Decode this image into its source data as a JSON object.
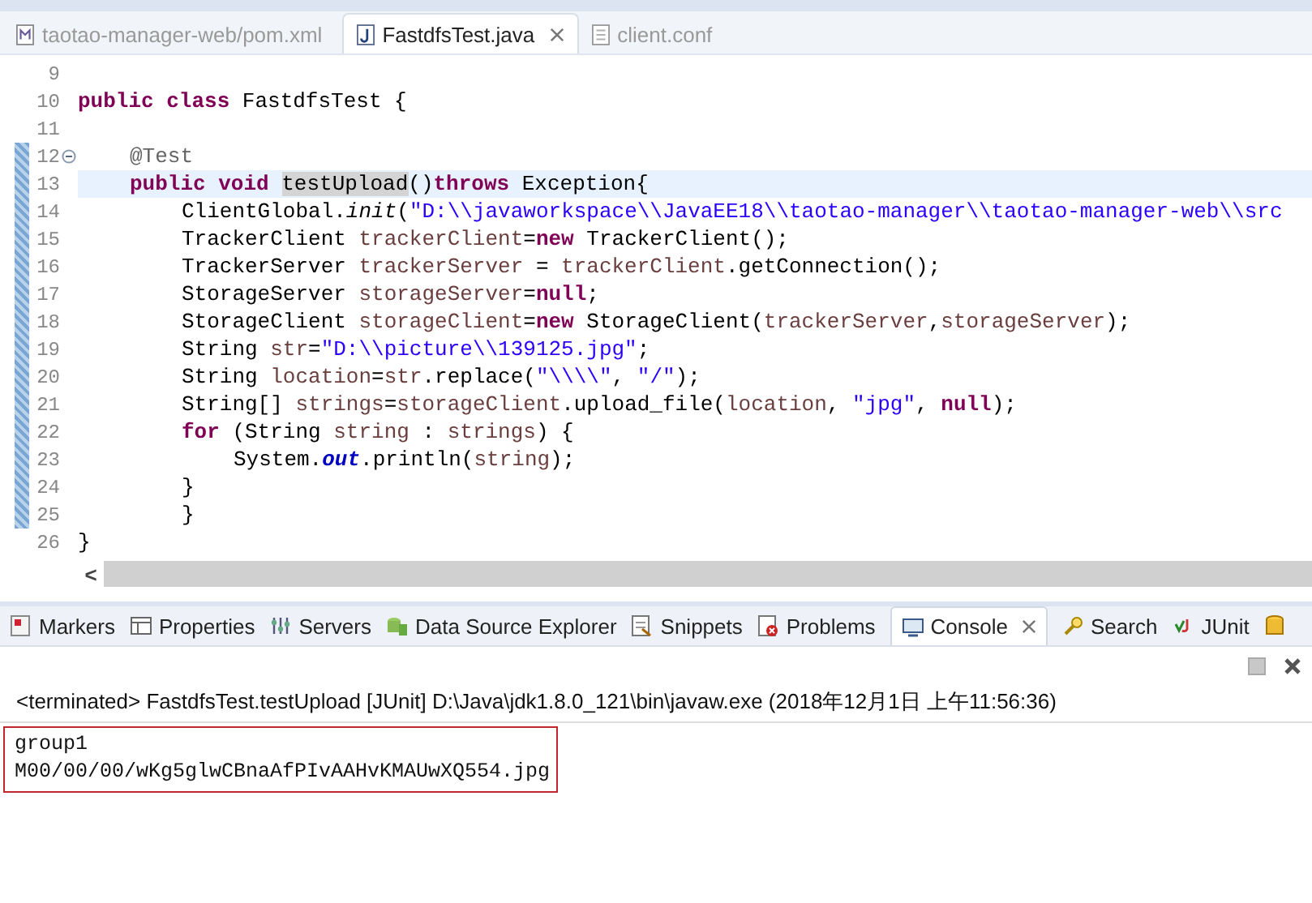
{
  "editor_tabs": [
    {
      "label": "taotao-manager-web/pom.xml",
      "selected": false
    },
    {
      "label": "FastdfsTest.java",
      "selected": true
    },
    {
      "label": "client.conf",
      "selected": false
    }
  ],
  "code_lines": [
    {
      "number": "9",
      "changed": false,
      "current": false,
      "fold": false
    },
    {
      "number": "10",
      "changed": false,
      "current": false,
      "fold": false,
      "segments": [
        {
          "kind": "kw",
          "text": "public "
        },
        {
          "kind": "kw",
          "text": "class"
        },
        {
          "kind": "plain",
          "text": " FastdfsTest {"
        }
      ],
      "children": [
        {
          "number": "11",
          "changed": false,
          "current": false,
          "fold": false
        },
        {
          "number": "12",
          "changed": true,
          "current": false,
          "fold": true,
          "segments": [
            {
              "kind": "annot",
              "text": "@Test"
            }
          ]
        },
        {
          "number": "13",
          "changed": true,
          "current": true,
          "fold": false,
          "segments": [
            {
              "kind": "kw",
              "text": "public "
            },
            {
              "kind": "kw",
              "text": "void "
            },
            {
              "kind": "occurrence",
              "text": "testUpload"
            },
            {
              "kind": "plain",
              "text": "()"
            },
            {
              "kind": "kw",
              "text": "throws"
            },
            {
              "kind": "plain",
              "text": " Exception{"
            }
          ],
          "children": [
            {
              "number": "14",
              "changed": true,
              "current": false,
              "fold": false,
              "segments": [
                {
                  "kind": "plain",
                  "text": "ClientGlobal."
                },
                {
                  "kind": "static",
                  "text": "init"
                },
                {
                  "kind": "plain",
                  "text": "("
                },
                {
                  "kind": "str",
                  "text": "\"D:\\\\javaworkspace\\\\JavaEE18\\\\taotao-manager\\\\taotao-manager-web\\\\src"
                }
              ]
            },
            {
              "number": "15",
              "changed": true,
              "current": false,
              "fold": false,
              "segments": [
                {
                  "kind": "plain",
                  "text": "TrackerClient "
                },
                {
                  "kind": "local",
                  "text": "trackerClient"
                },
                {
                  "kind": "plain",
                  "text": "="
                },
                {
                  "kind": "kw",
                  "text": "new"
                },
                {
                  "kind": "plain",
                  "text": " TrackerClient();"
                }
              ]
            },
            {
              "number": "16",
              "changed": true,
              "current": false,
              "fold": false,
              "segments": [
                {
                  "kind": "plain",
                  "text": "TrackerServer "
                },
                {
                  "kind": "local",
                  "text": "trackerServer"
                },
                {
                  "kind": "plain",
                  "text": " = "
                },
                {
                  "kind": "local",
                  "text": "trackerClient"
                },
                {
                  "kind": "plain",
                  "text": ".getConnection();"
                }
              ]
            },
            {
              "number": "17",
              "changed": true,
              "current": false,
              "fold": false,
              "segments": [
                {
                  "kind": "plain",
                  "text": "StorageServer "
                },
                {
                  "kind": "local",
                  "text": "storageServer"
                },
                {
                  "kind": "plain",
                  "text": "="
                },
                {
                  "kind": "kw",
                  "text": "null"
                },
                {
                  "kind": "plain",
                  "text": ";"
                }
              ]
            },
            {
              "number": "18",
              "changed": true,
              "current": false,
              "fold": false,
              "segments": [
                {
                  "kind": "plain",
                  "text": "StorageClient "
                },
                {
                  "kind": "local",
                  "text": "storageClient"
                },
                {
                  "kind": "plain",
                  "text": "="
                },
                {
                  "kind": "kw",
                  "text": "new"
                },
                {
                  "kind": "plain",
                  "text": " StorageClient("
                },
                {
                  "kind": "local",
                  "text": "trackerServer"
                },
                {
                  "kind": "plain",
                  "text": ","
                },
                {
                  "kind": "local",
                  "text": "storageServer"
                },
                {
                  "kind": "plain",
                  "text": ");"
                }
              ]
            },
            {
              "number": "19",
              "changed": true,
              "current": false,
              "fold": false,
              "segments": [
                {
                  "kind": "plain",
                  "text": "String "
                },
                {
                  "kind": "local",
                  "text": "str"
                },
                {
                  "kind": "plain",
                  "text": "="
                },
                {
                  "kind": "str",
                  "text": "\"D:\\\\picture\\\\139125.jpg\""
                },
                {
                  "kind": "plain",
                  "text": ";"
                }
              ]
            },
            {
              "number": "20",
              "changed": true,
              "current": false,
              "fold": false,
              "segments": [
                {
                  "kind": "plain",
                  "text": "String "
                },
                {
                  "kind": "local",
                  "text": "location"
                },
                {
                  "kind": "plain",
                  "text": "="
                },
                {
                  "kind": "local",
                  "text": "str"
                },
                {
                  "kind": "plain",
                  "text": ".replace("
                },
                {
                  "kind": "str",
                  "text": "\"\\\\\\\\\""
                },
                {
                  "kind": "plain",
                  "text": ", "
                },
                {
                  "kind": "str",
                  "text": "\"/\""
                },
                {
                  "kind": "plain",
                  "text": ");"
                }
              ]
            },
            {
              "number": "21",
              "changed": true,
              "current": false,
              "fold": false,
              "segments": [
                {
                  "kind": "plain",
                  "text": "String[] "
                },
                {
                  "kind": "local",
                  "text": "strings"
                },
                {
                  "kind": "plain",
                  "text": "="
                },
                {
                  "kind": "local",
                  "text": "storageClient"
                },
                {
                  "kind": "plain",
                  "text": ".upload_file("
                },
                {
                  "kind": "local",
                  "text": "location"
                },
                {
                  "kind": "plain",
                  "text": ", "
                },
                {
                  "kind": "str",
                  "text": "\"jpg\""
                },
                {
                  "kind": "plain",
                  "text": ", "
                },
                {
                  "kind": "kw",
                  "text": "null"
                },
                {
                  "kind": "plain",
                  "text": ");"
                }
              ]
            },
            {
              "number": "22",
              "changed": true,
              "current": false,
              "fold": false,
              "segments": [
                {
                  "kind": "kw",
                  "text": "for"
                },
                {
                  "kind": "plain",
                  "text": " (String "
                },
                {
                  "kind": "local",
                  "text": "string"
                },
                {
                  "kind": "plain",
                  "text": " : "
                },
                {
                  "kind": "local",
                  "text": "strings"
                },
                {
                  "kind": "plain",
                  "text": ") {"
                }
              ],
              "children": [
                {
                  "number": "23",
                  "changed": true,
                  "current": false,
                  "fold": false,
                  "segments": [
                    {
                      "kind": "plain",
                      "text": "System."
                    },
                    {
                      "kind": "sfield",
                      "text": "out"
                    },
                    {
                      "kind": "plain",
                      "text": ".println("
                    },
                    {
                      "kind": "local",
                      "text": "string"
                    },
                    {
                      "kind": "plain",
                      "text": ");"
                    }
                  ]
                }
              ]
            },
            {
              "number": "24",
              "changed": true,
              "current": false,
              "fold": false,
              "segments": [
                {
                  "kind": "plain",
                  "text": "}"
                }
              ]
            },
            {
              "number": "25",
              "changed": true,
              "current": false,
              "fold": false,
              "segments": [
                {
                  "kind": "plain",
                  "text": "}"
                }
              ]
            }
          ]
        }
      ]
    },
    {
      "number": "26",
      "changed": false,
      "current": false,
      "fold": false,
      "segments": [
        {
          "kind": "plain",
          "text": "}"
        }
      ]
    }
  ],
  "scroll_left": "<",
  "panel_tabs": [
    {
      "label": "Markers",
      "selected": false
    },
    {
      "label": "Properties",
      "selected": false
    },
    {
      "label": "Servers",
      "selected": false
    },
    {
      "label": "Data Source Explorer",
      "selected": false
    },
    {
      "label": "Snippets",
      "selected": false
    },
    {
      "label": "Problems",
      "selected": false
    },
    {
      "label": "Console",
      "selected": true
    },
    {
      "label": "Search",
      "selected": false
    },
    {
      "label": "JUnit",
      "selected": false
    }
  ],
  "console": {
    "header": "<terminated> FastdfsTest.testUpload [JUnit] D:\\Java\\jdk1.8.0_121\\bin\\javaw.exe (2018年12月1日 上午11:56:36)",
    "output": [
      "group1",
      "M00/00/00/wKg5glwCBnaAfPIvAAHvKMAUwXQ554.jpg"
    ],
    "output_highlighted": true
  }
}
